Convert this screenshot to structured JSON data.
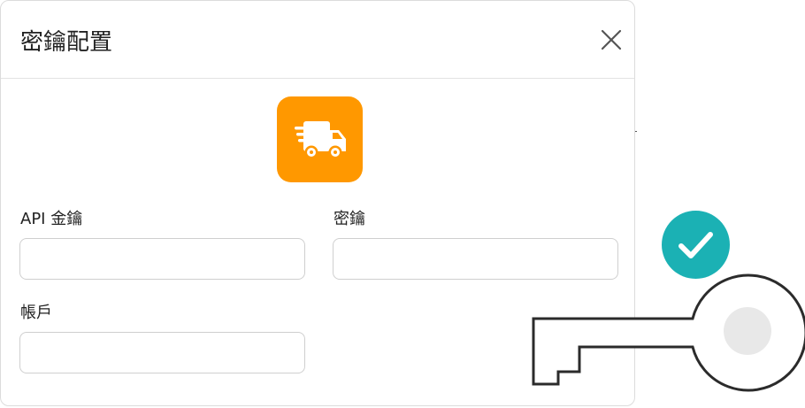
{
  "dialog": {
    "title": "密鑰配置",
    "close_icon": "close-icon",
    "app_icon": "delivery-truck-icon",
    "accent_color": "#ff9800"
  },
  "fields": {
    "api_key": {
      "label": "API 金鑰",
      "value": "",
      "placeholder": ""
    },
    "secret": {
      "label": "密鑰",
      "value": "",
      "placeholder": ""
    },
    "account": {
      "label": "帳戶",
      "value": "",
      "placeholder": ""
    }
  },
  "decoration": {
    "check_icon": "check-circle-icon",
    "check_color": "#1bb1b4",
    "key_icon": "key-icon"
  }
}
